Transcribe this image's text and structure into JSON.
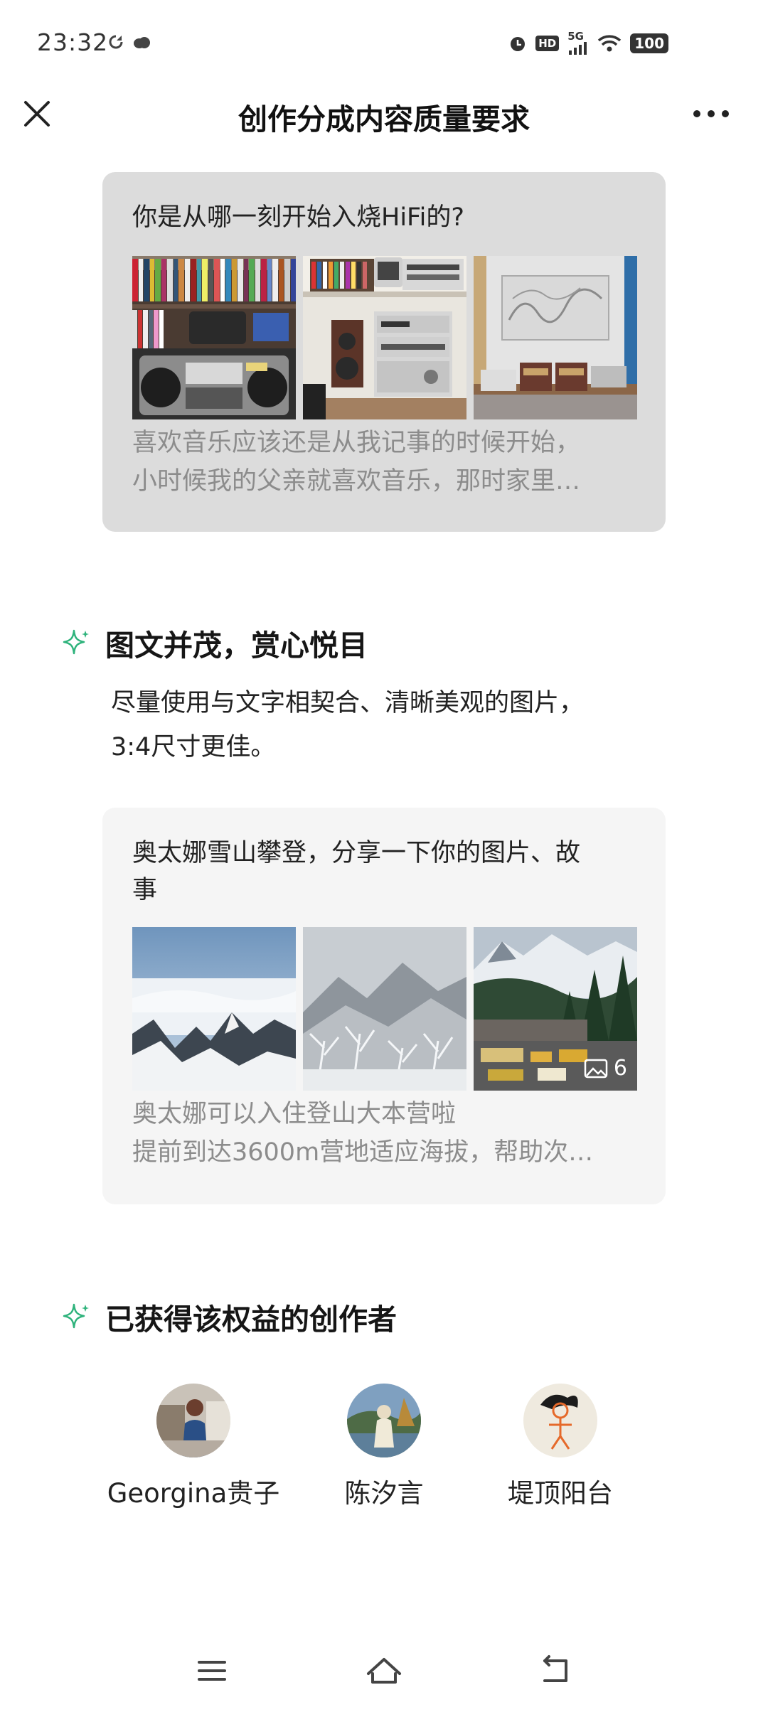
{
  "status_bar": {
    "time": "23:32",
    "network": "5G",
    "hd": "HD",
    "battery": "100"
  },
  "header": {
    "title": "创作分成内容质量要求"
  },
  "example_card_1": {
    "title": "你是从哪一刻开始入烧HiFi的?",
    "excerpt_line1": "喜欢音乐应该还是从我记事的时候开始，",
    "excerpt_line2": "小时候我的父亲就喜欢音乐，那时家里…"
  },
  "section_images": {
    "title": "图文并茂，赏心悦目",
    "desc_line1": "尽量使用与文字相契合、清晰美观的图片，",
    "desc_line2": "3:4尺寸更佳。"
  },
  "example_card_2": {
    "title_line1": "奥太娜雪山攀登，分享一下你的图片、故",
    "title_line2": "事",
    "image_count": "6",
    "excerpt_line1": "奥太娜可以入住登山大本营啦",
    "excerpt_line2": "提前到达3600m营地适应海拔，帮助次…"
  },
  "section_creators": {
    "title": "已获得该权益的创作者",
    "creators": [
      {
        "name": "Georgina贵子"
      },
      {
        "name": "陈汐言"
      },
      {
        "name": "堤顶阳台"
      }
    ]
  },
  "colors": {
    "accent_sparkle": "#2fb37c",
    "card_gray": "#dcdcdc",
    "card_light": "#f5f5f5",
    "muted_text": "#8c8c8c"
  },
  "icons": {
    "close": "close-icon",
    "more": "more-icon",
    "sparkle": "sparkle-icon",
    "image": "image-icon",
    "menu": "menu-icon",
    "home": "home-icon",
    "back": "back-icon"
  }
}
